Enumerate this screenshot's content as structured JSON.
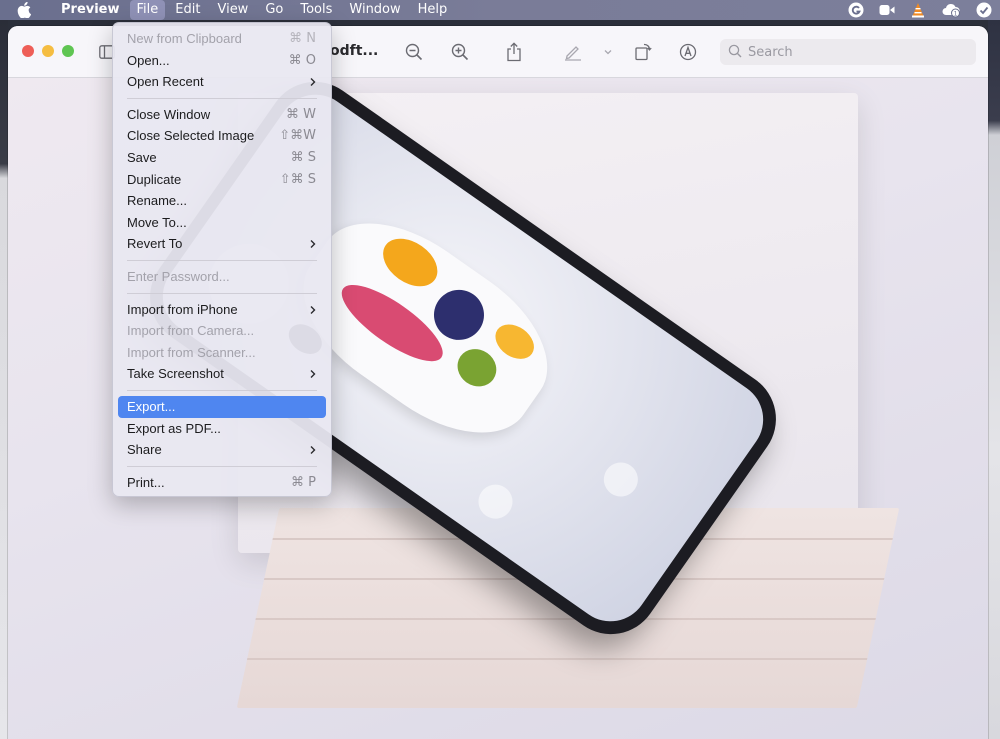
{
  "menubar": {
    "app_name": "Preview",
    "menus": [
      "File",
      "Edit",
      "View",
      "Go",
      "Tools",
      "Window",
      "Help"
    ],
    "active_menu": "File",
    "status_icons": [
      "grammarly-icon",
      "facetime-icon",
      "vlc-icon",
      "creative-cloud-icon",
      "checkmark-icon"
    ]
  },
  "window": {
    "title": "odft...",
    "search_placeholder": "Search",
    "toolbar_icons": [
      "sidebar-icon",
      "zoom-out-icon",
      "zoom-in-icon",
      "share-icon",
      "markup-pen-icon",
      "chevron-down-icon",
      "rotate-icon",
      "annotate-icon"
    ]
  },
  "file_menu": {
    "groups": [
      [
        {
          "label": "New from Clipboard",
          "shortcut": "⌘ N",
          "disabled": true
        },
        {
          "label": "Open...",
          "shortcut": "⌘ O",
          "disabled": false
        },
        {
          "label": "Open Recent",
          "submenu": true,
          "disabled": false
        }
      ],
      [
        {
          "label": "Close Window",
          "shortcut": "⌘ W",
          "disabled": false
        },
        {
          "label": "Close Selected Image",
          "shortcut": "⇧⌘W",
          "disabled": false
        },
        {
          "label": "Save",
          "shortcut": "⌘ S",
          "disabled": false
        },
        {
          "label": "Duplicate",
          "shortcut": "⇧⌘ S",
          "disabled": false
        },
        {
          "label": "Rename...",
          "disabled": false
        },
        {
          "label": "Move To...",
          "disabled": false
        },
        {
          "label": "Revert To",
          "submenu": true,
          "disabled": false
        }
      ],
      [
        {
          "label": "Enter Password...",
          "disabled": true
        }
      ],
      [
        {
          "label": "Import from iPhone",
          "submenu": true,
          "disabled": false
        },
        {
          "label": "Import from Camera...",
          "disabled": true
        },
        {
          "label": "Import from Scanner...",
          "disabled": true
        },
        {
          "label": "Take Screenshot",
          "submenu": true,
          "disabled": false
        }
      ],
      [
        {
          "label": "Export...",
          "highlighted": true,
          "disabled": false
        },
        {
          "label": "Export as PDF...",
          "disabled": false
        },
        {
          "label": "Share",
          "submenu": true,
          "disabled": false
        }
      ],
      [
        {
          "label": "Print...",
          "shortcut": "⌘ P",
          "disabled": false
        }
      ]
    ]
  },
  "colors": {
    "menubar": "#757894",
    "highlight": "#4f86f0",
    "disabled_text": "#a3a2ab"
  }
}
